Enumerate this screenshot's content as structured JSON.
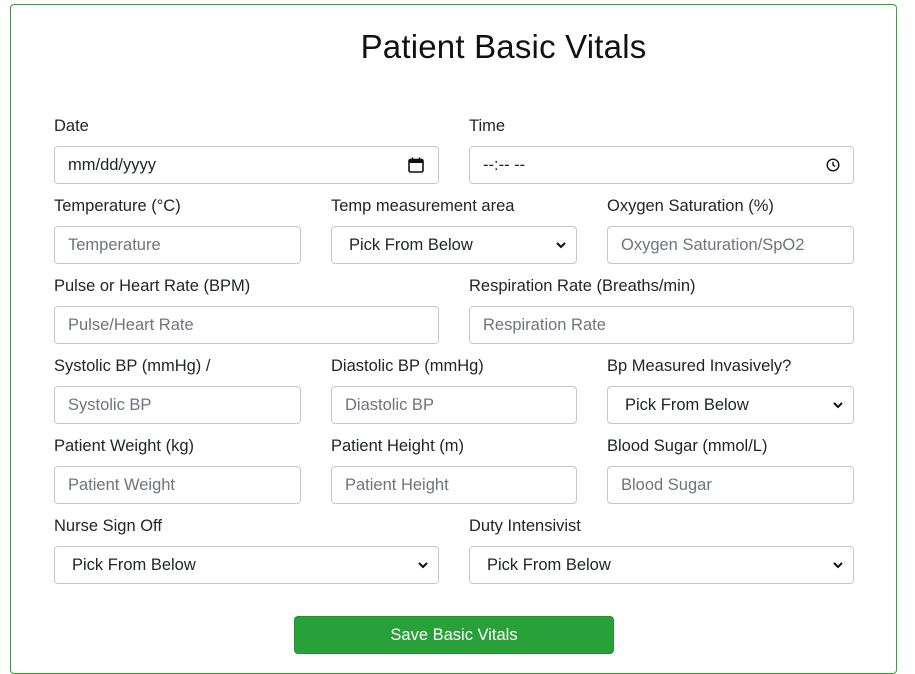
{
  "form": {
    "title": "Patient Basic Vitals",
    "date": {
      "label": "Date",
      "value": "mm/dd/yyyy"
    },
    "time": {
      "label": "Time",
      "value": "--:-- --"
    },
    "temperature": {
      "label": "Temperature (°C)",
      "placeholder": "Temperature"
    },
    "temp_area": {
      "label": "Temp measurement area",
      "selected": "Pick From Below"
    },
    "oxygen": {
      "label": "Oxygen Saturation (%)",
      "placeholder": "Oxygen Saturation/SpO2"
    },
    "pulse": {
      "label": "Pulse or Heart Rate (BPM)",
      "placeholder": "Pulse/Heart Rate"
    },
    "respiration": {
      "label": "Respiration Rate (Breaths/min)",
      "placeholder": "Respiration Rate"
    },
    "systolic": {
      "label": "Systolic BP (mmHg) /",
      "placeholder": "Systolic BP"
    },
    "diastolic": {
      "label": "Diastolic BP (mmHg)",
      "placeholder": "Diastolic BP"
    },
    "bp_invasive": {
      "label": "Bp Measured Invasively?",
      "selected": "Pick From Below"
    },
    "weight": {
      "label": "Patient Weight (kg)",
      "placeholder": "Patient Weight"
    },
    "height": {
      "label": "Patient Height (m)",
      "placeholder": "Patient Height"
    },
    "blood_sugar": {
      "label": "Blood Sugar (mmol/L)",
      "placeholder": "Blood Sugar"
    },
    "nurse": {
      "label": "Nurse Sign Off",
      "selected": "Pick From Below"
    },
    "intensivist": {
      "label": "Duty Intensivist",
      "selected": "Pick From Below"
    },
    "save_label": "Save Basic Vitals"
  },
  "colors": {
    "border_accent": "#33a133",
    "save_button": "#28a138"
  },
  "icons": {
    "date": "calendar-icon",
    "time": "clock-icon",
    "select": "chevron-down-icon"
  }
}
